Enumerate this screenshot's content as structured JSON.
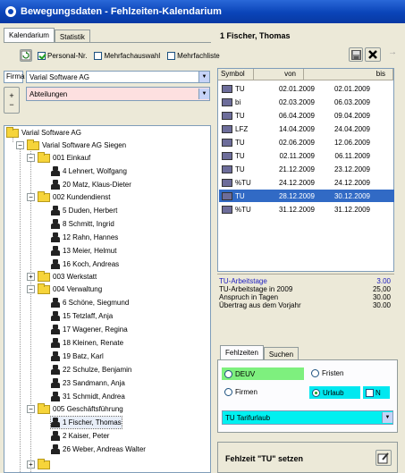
{
  "window": {
    "title": "Bewegungsdaten - Fehlzeiten-Kalendarium"
  },
  "tabs": [
    {
      "label": "Kalendarium"
    },
    {
      "label": "Statistik"
    }
  ],
  "person_header": "1 Fischer, Thomas",
  "options": {
    "personalnr": "Personal-Nr.",
    "mehrfachauswahl": "Mehrfachauswahl",
    "mehrfachliste": "Mehrfachliste"
  },
  "firma": {
    "label": "Firma",
    "value": "Varial Software AG"
  },
  "abteilungen": {
    "value": "Abteilungen"
  },
  "tree": [
    {
      "label": "Varial Software AG"
    },
    {
      "label": "Varial Software AG Siegen"
    },
    {
      "label": "001 Einkauf"
    },
    {
      "label": "4 Lehnert, Wolfgang"
    },
    {
      "label": "20 Matz, Klaus-Dieter"
    },
    {
      "label": "002 Kundendienst"
    },
    {
      "label": "5 Duden, Herbert"
    },
    {
      "label": "8 Schmitt, Ingrid"
    },
    {
      "label": "12 Rahn, Hannes"
    },
    {
      "label": "13 Meier, Helmut"
    },
    {
      "label": "16 Koch, Andreas"
    },
    {
      "label": "003 Werkstatt"
    },
    {
      "label": "004 Verwaltung"
    },
    {
      "label": "6 Schöne, Siegmund"
    },
    {
      "label": "15 Tetzlaff, Anja"
    },
    {
      "label": "17 Wagener, Regina"
    },
    {
      "label": "18 Kleinen, Renate"
    },
    {
      "label": "19 Batz, Karl"
    },
    {
      "label": "22 Schulze, Benjamin"
    },
    {
      "label": "23 Sandmann, Anja"
    },
    {
      "label": "31 Schmidt, Andrea"
    },
    {
      "label": "005 Geschäftsführung"
    },
    {
      "label": "1 Fischer, Thomas"
    },
    {
      "label": "2 Kaiser, Peter"
    },
    {
      "label": "26 Weber, Andreas Walter"
    }
  ],
  "table": {
    "headers": {
      "symbol": "Symbol",
      "von": "von",
      "bis": "bis"
    },
    "rows": [
      {
        "symbol": "TU",
        "von": "02.01.2009",
        "bis": "02.01.2009"
      },
      {
        "symbol": "bi",
        "von": "02.03.2009",
        "bis": "06.03.2009"
      },
      {
        "symbol": "TU",
        "von": "06.04.2009",
        "bis": "09.04.2009"
      },
      {
        "symbol": "LFZ",
        "von": "14.04.2009",
        "bis": "24.04.2009"
      },
      {
        "symbol": "TU",
        "von": "02.06.2009",
        "bis": "12.06.2009"
      },
      {
        "symbol": "TU",
        "von": "02.11.2009",
        "bis": "06.11.2009"
      },
      {
        "symbol": "TU",
        "von": "21.12.2009",
        "bis": "23.12.2009"
      },
      {
        "symbol": "%TU",
        "von": "24.12.2009",
        "bis": "24.12.2009"
      },
      {
        "symbol": "TU",
        "von": "28.12.2009",
        "bis": "30.12.2009"
      },
      {
        "symbol": "%TU",
        "von": "31.12.2009",
        "bis": "31.12.2009"
      }
    ]
  },
  "stats": [
    {
      "label": "TU-Arbeitstage",
      "value": "3.00"
    },
    {
      "label": "TU-Arbeitstage in 2009",
      "value": "25,00"
    },
    {
      "label": "Anspruch in Tagen",
      "value": "30.00"
    },
    {
      "label": "Übertrag aus dem Vorjahr",
      "value": "30.00"
    }
  ],
  "bottom_tabs": [
    {
      "label": "Fehlzeiten"
    },
    {
      "label": "Suchen"
    }
  ],
  "radios": {
    "deuv": "DEUV",
    "fristen": "Fristen",
    "firmen": "Firmen",
    "urlaub": "Urlaub",
    "n": "N"
  },
  "fehlzeit_select": {
    "value": "TU Tarifurlaub"
  },
  "set_label": "Fehlzeit \"TU\" setzen",
  "colors": {
    "title": "#0a44b8",
    "selection": "#316ac5",
    "deuv_bg": "#7ef07e",
    "urlaub_bg": "#00e8f0",
    "combo_bg": "#00f0f0",
    "abteilungen_bg": "#fde0e0"
  }
}
